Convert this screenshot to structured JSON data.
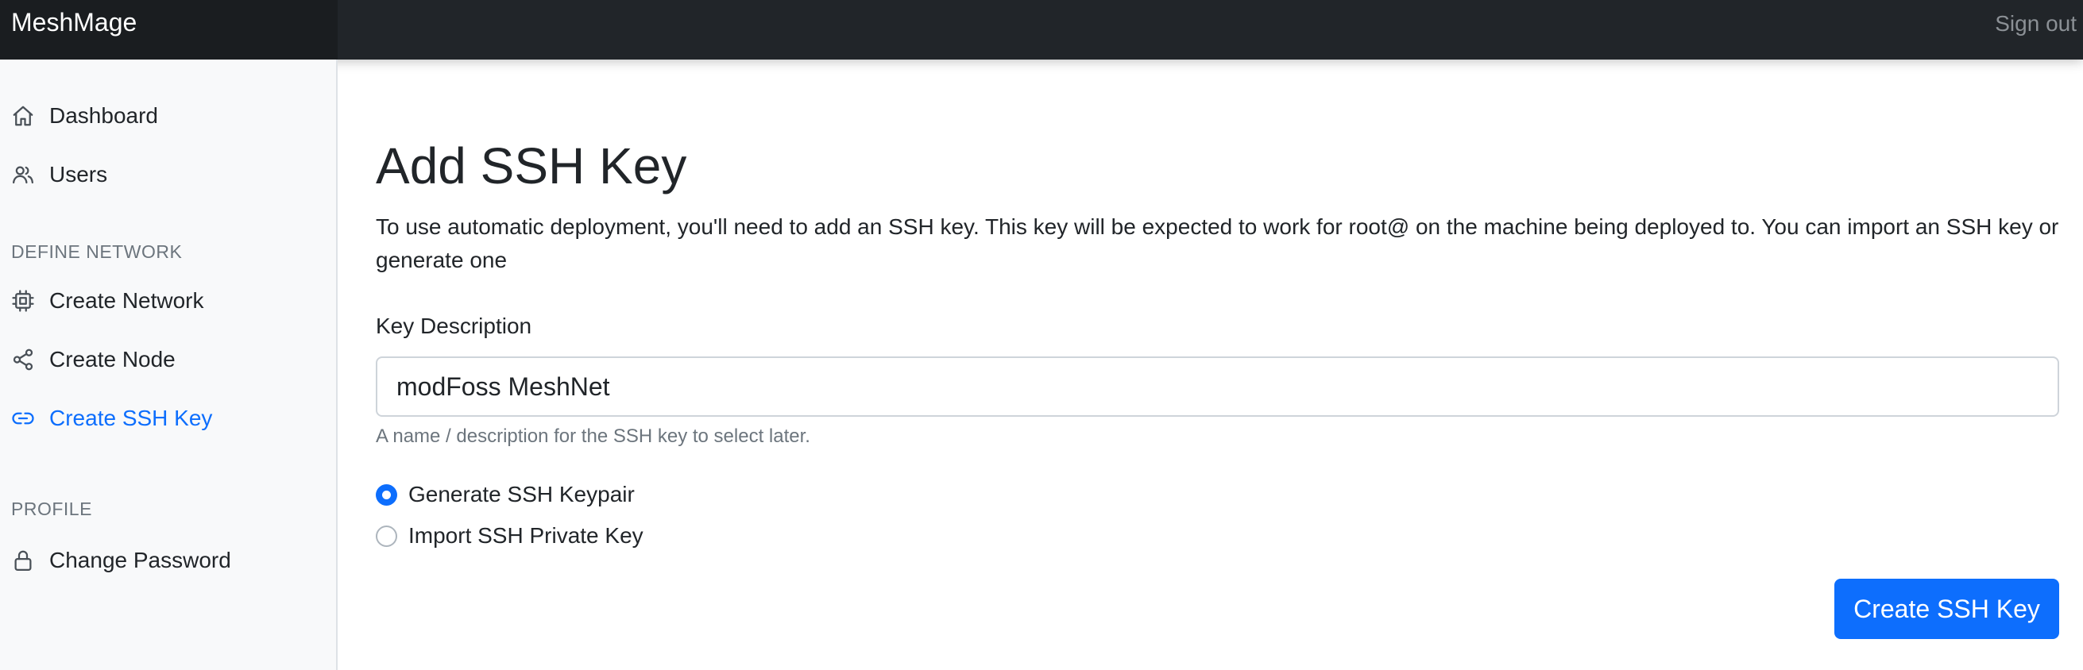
{
  "app": {
    "brand": "MeshMage",
    "sign_out": "Sign out"
  },
  "sidebar": {
    "items": [
      {
        "label": "Dashboard",
        "icon": "home-icon"
      },
      {
        "label": "Users",
        "icon": "users-icon"
      }
    ],
    "define_network": {
      "heading": "DEFINE NETWORK",
      "items": [
        {
          "label": "Create Network",
          "icon": "cpu-icon"
        },
        {
          "label": "Create Node",
          "icon": "share-icon"
        },
        {
          "label": "Create SSH Key",
          "icon": "link-icon",
          "active": true
        }
      ]
    },
    "profile": {
      "heading": "PROFILE",
      "items": [
        {
          "label": "Change Password",
          "icon": "lock-icon"
        }
      ]
    }
  },
  "main": {
    "title": "Add SSH Key",
    "intro": "To use automatic deployment, you'll need to add an SSH key. This key will be expected to work for root@ on the machine being deployed to. You can import an SSH key or generate one",
    "key_description": {
      "label": "Key Description",
      "value": "modFoss MeshNet",
      "help": "A name / description for the SSH key to select later."
    },
    "options": [
      {
        "label": "Generate SSH Keypair",
        "selected": true
      },
      {
        "label": "Import SSH Private Key",
        "selected": false
      }
    ],
    "submit_label": "Create SSH Key"
  },
  "colors": {
    "topbar": "#212529",
    "accent": "#0d6efd",
    "sidebar_bg": "#f8f9fa",
    "muted": "#6c757d"
  }
}
